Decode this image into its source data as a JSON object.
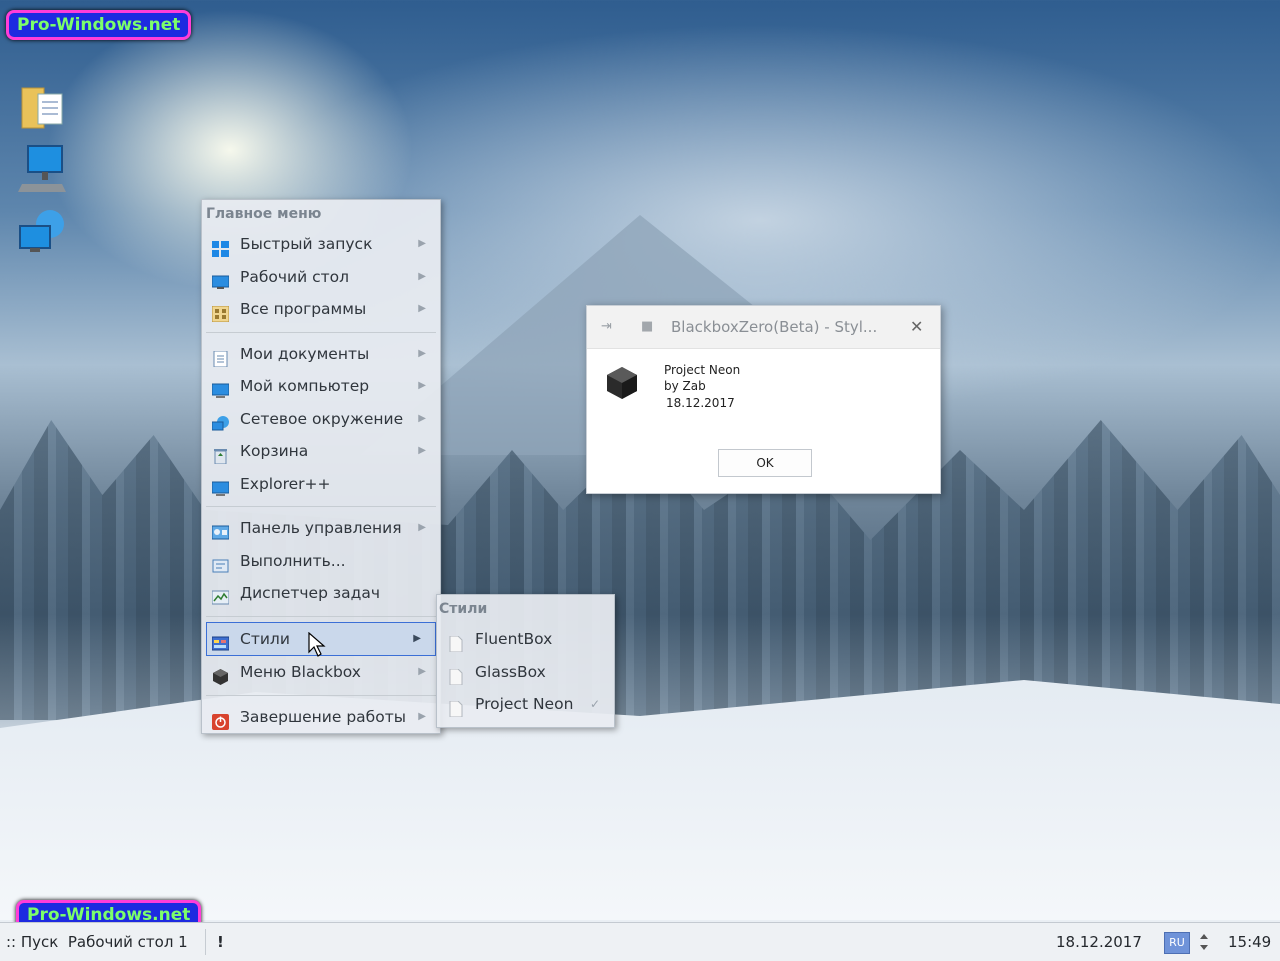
{
  "watermarks": [
    "Pro-Windows.net",
    "Pro-Windows.net"
  ],
  "desktop_icons": [
    "folder-documents-icon",
    "my-computer-icon",
    "network-icon"
  ],
  "main_menu": {
    "title": "Главное меню",
    "items": [
      {
        "label": "Быстрый запуск",
        "icon": "windows-logo-icon",
        "arrow": "▶"
      },
      {
        "label": "Рабочий стол",
        "icon": "desktop-icon",
        "arrow": "▶"
      },
      {
        "label": "Все программы",
        "icon": "programs-icon",
        "arrow": "▶"
      },
      {
        "label": "Мои документы",
        "icon": "documents-icon",
        "arrow": "▶"
      },
      {
        "label": "Мой компьютер",
        "icon": "computer-icon",
        "arrow": "▶"
      },
      {
        "label": "Сетевое окружение",
        "icon": "network-icon",
        "arrow": "▶"
      },
      {
        "label": "Корзина",
        "icon": "recycle-bin-icon",
        "arrow": "▶"
      },
      {
        "label": "Explorer++",
        "icon": "explorer-icon"
      },
      {
        "label": "Панель управления",
        "icon": "control-panel-icon",
        "arrow": "▶"
      },
      {
        "label": "Выполнить...",
        "icon": "run-icon"
      },
      {
        "label": "Диспетчер задач",
        "icon": "task-manager-icon"
      },
      {
        "label": "Стили",
        "icon": "styles-icon",
        "arrow": "▶"
      },
      {
        "label": "Меню Blackbox",
        "icon": "blackbox-cube-icon",
        "arrow": "▶"
      },
      {
        "label": "Завершение работы",
        "icon": "shutdown-icon",
        "arrow": "▶"
      }
    ]
  },
  "styles_submenu": {
    "title": "Стили",
    "items": [
      {
        "label": "FluentBox",
        "icon": "file-icon"
      },
      {
        "label": "GlassBox",
        "icon": "file-icon"
      },
      {
        "label": "Project Neon",
        "icon": "file-icon",
        "check": "✓"
      }
    ]
  },
  "dialog": {
    "title": "BlackboxZero(Beta) - Styl...",
    "pin_glyph": "⇥",
    "square_glyph": "■",
    "close_glyph": "✕",
    "line1": "Project Neon",
    "line2": "by Zab",
    "line3": "18.12.2017",
    "ok_label": "OK"
  },
  "taskbar": {
    "start_text": ":: Пуск  Рабочий стол 1",
    "exclaim": "!",
    "date": "18.12.2017",
    "lang": "RU",
    "time": "15:49"
  },
  "colors": {
    "accent": "#3b6fd6",
    "shutdown_red": "#d8432e",
    "menu_bg": "#e8ecf1"
  }
}
